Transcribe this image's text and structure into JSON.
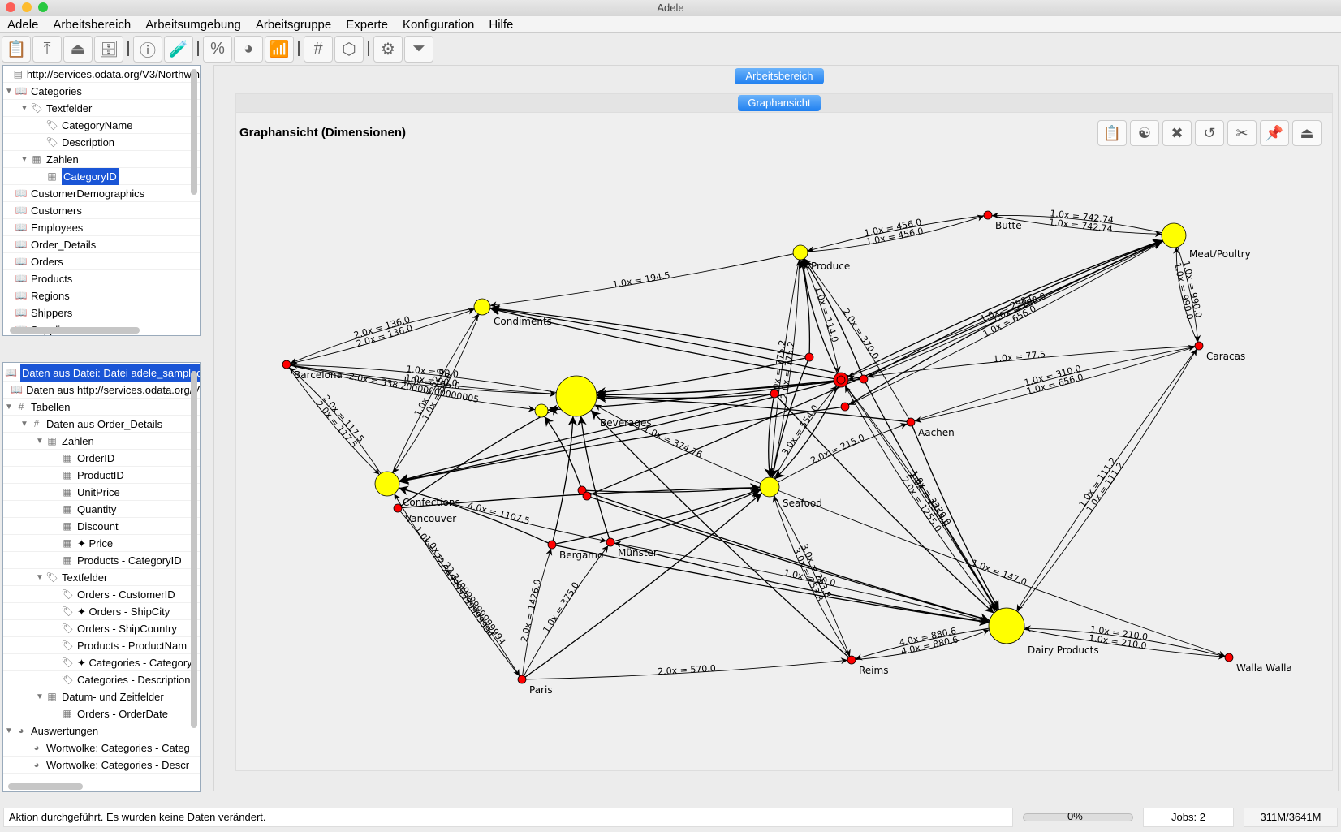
{
  "window": {
    "title": "Adele"
  },
  "menu": [
    "Adele",
    "Arbeitsbereich",
    "Arbeitsumgebung",
    "Arbeitsgruppe",
    "Experte",
    "Konfiguration",
    "Hilfe"
  ],
  "toolbar": [
    {
      "icon": "clipboard-icon",
      "g": "📋"
    },
    {
      "icon": "upload-icon",
      "g": "⤒"
    },
    {
      "icon": "eject-upload-icon",
      "g": "⏏"
    },
    {
      "icon": "cabinet-icon",
      "g": "🗄"
    },
    {
      "sep": true
    },
    {
      "icon": "info-icon",
      "g": "ⓘ"
    },
    {
      "icon": "test-tube-icon",
      "g": "🧪"
    },
    {
      "sep": true
    },
    {
      "icon": "percent-icon",
      "g": "%"
    },
    {
      "icon": "pie-chart-icon",
      "g": "◕"
    },
    {
      "icon": "bar-chart-icon",
      "g": "📶"
    },
    {
      "sep": true
    },
    {
      "icon": "grid-icon",
      "g": "#"
    },
    {
      "icon": "cube-icon",
      "g": "⬡"
    },
    {
      "sep": true
    },
    {
      "icon": "gear-bug-icon",
      "g": "⚙"
    },
    {
      "icon": "funnel-icon",
      "g": "⏷"
    }
  ],
  "source_tree": [
    {
      "label": "http://services.odata.org/V3/Northwin",
      "lvl": 0,
      "icon": "server-icon",
      "g": "▤"
    },
    {
      "label": "Categories",
      "lvl": 0,
      "icon": "book-icon",
      "g": "📖",
      "tw": "▼"
    },
    {
      "label": "Textfelder",
      "lvl": 1,
      "icon": "tag-icon",
      "g": "🏷",
      "tw": "▼"
    },
    {
      "label": "CategoryName",
      "lvl": 2,
      "icon": "tag-icon",
      "g": "🏷"
    },
    {
      "label": "Description",
      "lvl": 2,
      "icon": "tag-icon",
      "g": "🏷"
    },
    {
      "label": "Zahlen",
      "lvl": 1,
      "icon": "calculator-icon",
      "g": "▦",
      "tw": "▼"
    },
    {
      "label": "CategoryID",
      "lvl": 2,
      "icon": "calculator-icon",
      "g": "▦",
      "selected": true
    },
    {
      "label": "CustomerDemographics",
      "lvl": 0,
      "icon": "book-icon",
      "g": "📖"
    },
    {
      "label": "Customers",
      "lvl": 0,
      "icon": "book-icon",
      "g": "📖"
    },
    {
      "label": "Employees",
      "lvl": 0,
      "icon": "book-icon",
      "g": "📖"
    },
    {
      "label": "Order_Details",
      "lvl": 0,
      "icon": "book-icon",
      "g": "📖"
    },
    {
      "label": "Orders",
      "lvl": 0,
      "icon": "book-icon",
      "g": "📖"
    },
    {
      "label": "Products",
      "lvl": 0,
      "icon": "book-icon",
      "g": "📖"
    },
    {
      "label": "Regions",
      "lvl": 0,
      "icon": "book-icon",
      "g": "📖"
    },
    {
      "label": "Shippers",
      "lvl": 0,
      "icon": "book-icon",
      "g": "📖"
    },
    {
      "label": "Suppliers",
      "lvl": 0,
      "icon": "book-icon",
      "g": "📖"
    }
  ],
  "data_tree": [
    {
      "label": "Daten aus Datei: Datei adele_sampled",
      "lvl": 0,
      "icon": "book-icon",
      "g": "📖",
      "selected": true
    },
    {
      "label": "Daten aus http://services.odata.org/V",
      "lvl": 0,
      "icon": "book-icon",
      "g": "📖"
    },
    {
      "label": "Tabellen",
      "lvl": 0,
      "icon": "grid-icon",
      "g": "#",
      "tw": "▼"
    },
    {
      "label": "Daten aus Order_Details",
      "lvl": 1,
      "icon": "grid-icon",
      "g": "#",
      "tw": "▼"
    },
    {
      "label": "Zahlen",
      "lvl": 2,
      "icon": "calculator-icon",
      "g": "▦",
      "tw": "▼"
    },
    {
      "label": "OrderID",
      "lvl": 3,
      "icon": "calculator-icon",
      "g": "▦"
    },
    {
      "label": "ProductID",
      "lvl": 3,
      "icon": "calculator-icon",
      "g": "▦"
    },
    {
      "label": "UnitPrice",
      "lvl": 3,
      "icon": "calculator-icon",
      "g": "▦"
    },
    {
      "label": "Quantity",
      "lvl": 3,
      "icon": "calculator-icon",
      "g": "▦"
    },
    {
      "label": "Discount",
      "lvl": 3,
      "icon": "calculator-icon",
      "g": "▦"
    },
    {
      "label": "✦ Price",
      "lvl": 3,
      "icon": "calculator-icon",
      "g": "▦"
    },
    {
      "label": "Products - CategoryID",
      "lvl": 3,
      "icon": "calculator-icon",
      "g": "▦"
    },
    {
      "label": "Textfelder",
      "lvl": 2,
      "icon": "tag-icon",
      "g": "🏷",
      "tw": "▼"
    },
    {
      "label": "Orders - CustomerID",
      "lvl": 3,
      "icon": "tag-icon",
      "g": "🏷"
    },
    {
      "label": "✦ Orders - ShipCity",
      "lvl": 3,
      "icon": "tag-icon",
      "g": "🏷"
    },
    {
      "label": "Orders - ShipCountry",
      "lvl": 3,
      "icon": "tag-icon",
      "g": "🏷"
    },
    {
      "label": "Products - ProductNam",
      "lvl": 3,
      "icon": "tag-icon",
      "g": "🏷"
    },
    {
      "label": "✦ Categories - Category",
      "lvl": 3,
      "icon": "tag-icon",
      "g": "🏷"
    },
    {
      "label": "Categories - Description",
      "lvl": 3,
      "icon": "tag-icon",
      "g": "🏷"
    },
    {
      "label": "Datum- und Zeitfelder",
      "lvl": 2,
      "icon": "calendar-icon",
      "g": "▦",
      "tw": "▼"
    },
    {
      "label": "Orders - OrderDate",
      "lvl": 3,
      "icon": "calendar-icon",
      "g": "▦"
    },
    {
      "label": "Auswertungen",
      "lvl": 0,
      "icon": "pie-chart-icon",
      "g": "◕",
      "tw": "▼"
    },
    {
      "label": "Wortwolke: Categories - Categ",
      "lvl": 1,
      "icon": "pie-chart-icon",
      "g": "◕"
    },
    {
      "label": "Wortwolke: Categories - Descr",
      "lvl": 1,
      "icon": "pie-chart-icon",
      "g": "◕"
    }
  ],
  "workspace": {
    "tab": "Arbeitsbereich",
    "subtab": "Graphansicht",
    "title": "Graphansicht (Dimensionen)"
  },
  "graph_toolbar": [
    {
      "icon": "clipboard-icon",
      "g": "📋"
    },
    {
      "icon": "yin-yang-icon",
      "g": "☯"
    },
    {
      "icon": "close-icon",
      "g": "✖"
    },
    {
      "icon": "refresh-icon",
      "g": "↺"
    },
    {
      "icon": "tools-icon",
      "g": "✂"
    },
    {
      "icon": "pin-icon",
      "g": "📌"
    },
    {
      "icon": "eject-icon",
      "g": "⏏"
    }
  ],
  "graph": {
    "colors": {
      "category": "#ffff00",
      "city": "#ff0000",
      "edge": "#000000"
    },
    "nodes": [
      {
        "id": "butte",
        "name": "Butte",
        "type": "city"
      },
      {
        "id": "meat",
        "name": "Meat/Poultry",
        "type": "category"
      },
      {
        "id": "caracas",
        "name": "Caracas",
        "type": "city"
      },
      {
        "id": "walla",
        "name": "Walla Walla",
        "type": "city"
      },
      {
        "id": "dairy",
        "name": "Dairy Products",
        "type": "category"
      },
      {
        "id": "reims",
        "name": "Reims",
        "type": "city"
      },
      {
        "id": "paris",
        "name": "Paris",
        "type": "city"
      },
      {
        "id": "seafood",
        "name": "Seafood",
        "type": "category"
      },
      {
        "id": "munster",
        "name": "Münster",
        "type": "city"
      },
      {
        "id": "bergamo",
        "name": "Bergamo",
        "type": "city"
      },
      {
        "id": "vancouver",
        "name": "Vancouver",
        "type": "city"
      },
      {
        "id": "confections",
        "name": "Confections",
        "type": "category"
      },
      {
        "id": "barcelona",
        "name": "Barcelona",
        "type": "city"
      },
      {
        "id": "condiments",
        "name": "Condiments",
        "type": "category"
      },
      {
        "id": "beverages",
        "name": "Beverages",
        "type": "category"
      },
      {
        "id": "grains",
        "name": "",
        "type": "category"
      },
      {
        "id": "produce",
        "name": "Produce",
        "type": "category"
      },
      {
        "id": "aachen",
        "name": "Aachen",
        "type": "city"
      },
      {
        "id": "hub",
        "name": "",
        "type": "city"
      },
      {
        "id": "c1",
        "name": "",
        "type": "city"
      },
      {
        "id": "c2",
        "name": "",
        "type": "city"
      },
      {
        "id": "c3",
        "name": "",
        "type": "city"
      },
      {
        "id": "c4",
        "name": "",
        "type": "city"
      },
      {
        "id": "c5",
        "name": "",
        "type": "city"
      },
      {
        "id": "c6",
        "name": "",
        "type": "city"
      }
    ],
    "edges": [
      [
        "butte",
        "meat",
        "1.0x = 742.74"
      ],
      [
        "meat",
        "butte",
        "1.0x = 742.74"
      ],
      [
        "butte",
        "produce",
        "1.0x = 456.0"
      ],
      [
        "produce",
        "butte",
        "1.0x = 456.0"
      ],
      [
        "produce",
        "condiments",
        "1.0x = 194.5"
      ],
      [
        "barcelona",
        "condiments",
        "2.0x = 136.0"
      ],
      [
        "condiments",
        "barcelona",
        "2.0x = 136.0"
      ],
      [
        "barcelona",
        "beverages",
        "1.0x = 90.0"
      ],
      [
        "beverages",
        "barcelona",
        "1.0x = 90.0"
      ],
      [
        "barcelona",
        "grains",
        "2.0x = 338.20000000000005"
      ],
      [
        "barcelona",
        "beverages",
        "1.0x = 155.0"
      ],
      [
        "barcelona",
        "confections",
        "2.0x = 117.5"
      ],
      [
        "confections",
        "barcelona",
        "2.0x = 117.5"
      ],
      [
        "confections",
        "condiments",
        "1.0x = 52.0"
      ],
      [
        "condiments",
        "confections",
        "1.0x = 52.0"
      ],
      [
        "meat",
        "caracas",
        "1.0x = 990.0"
      ],
      [
        "caracas",
        "meat",
        "1.0x = 990.0"
      ],
      [
        "meat",
        "hub",
        "1.0x = 298.0"
      ],
      [
        "meat",
        "c4",
        "1.0x = 656.0"
      ],
      [
        "caracas",
        "aachen",
        "1.0x = 656.0"
      ],
      [
        "caracas",
        "dairy",
        "1.0x = 111.2"
      ],
      [
        "dairy",
        "caracas",
        "1.0x = 111.2"
      ],
      [
        "caracas",
        "hub",
        "1.0x = 77.5"
      ],
      [
        "aachen",
        "caracas",
        "1.0x = 310.0"
      ],
      [
        "dairy",
        "walla",
        "1.0x = 210.0"
      ],
      [
        "walla",
        "dairy",
        "1.0x = 210.0"
      ],
      [
        "seafood",
        "walla",
        "1.0x = 147.0"
      ],
      [
        "dairy",
        "reims",
        "4.0x = 880.6"
      ],
      [
        "reims",
        "dairy",
        "4.0x = 880.6"
      ],
      [
        "paris",
        "reims",
        "2.0x = 570.0"
      ],
      [
        "seafood",
        "reims",
        "3.0x = 253.8"
      ],
      [
        "reims",
        "seafood",
        "3.0x = 253.8"
      ],
      [
        "paris",
        "bergamo",
        "2.0x = 1426.0"
      ],
      [
        "paris",
        "munster",
        "1.0x = 375.0"
      ],
      [
        "vancouver",
        "paris",
        "1.0x = 22.349999999999994"
      ],
      [
        "paris",
        "confections",
        "1.0x = 22.349999999999994"
      ],
      [
        "seafood",
        "beverages",
        "1.0x = 374.76"
      ],
      [
        "hub",
        "dairy",
        "2.0x = 1255.0"
      ],
      [
        "dairy",
        "hub",
        "2.0x = 1255.0"
      ],
      [
        "produce",
        "seafood",
        "2.0x = 775.2"
      ],
      [
        "seafood",
        "produce",
        "2.0x = 775.2"
      ],
      [
        "aachen",
        "produce",
        "2.0x = 370.0"
      ],
      [
        "meat",
        "c3",
        "1.0x = 298.0"
      ],
      [
        "seafood",
        "hub",
        "3.0x = 554.0"
      ],
      [
        "seafood",
        "aachen",
        "2.0x = 215.0"
      ],
      [
        "confections",
        "munster",
        "4.0x = 1107.5"
      ],
      [
        "dairy",
        "munster",
        "1.0x = 30.0"
      ],
      [
        "hub",
        "dairy",
        "1.0x = 3270.0"
      ],
      [
        "produce",
        "hub",
        "1.0x = 114.0"
      ],
      [
        "hub",
        "beverages",
        ""
      ],
      [
        "c1",
        "beverages",
        ""
      ],
      [
        "c2",
        "beverages",
        ""
      ],
      [
        "c3",
        "beverages",
        ""
      ],
      [
        "c4",
        "confections",
        ""
      ],
      [
        "hub",
        "confections",
        ""
      ],
      [
        "c2",
        "confections",
        ""
      ],
      [
        "hub",
        "condiments",
        ""
      ],
      [
        "c1",
        "condiments",
        ""
      ],
      [
        "c3",
        "condiments",
        ""
      ],
      [
        "hub",
        "produce",
        ""
      ],
      [
        "c3",
        "produce",
        ""
      ],
      [
        "c5",
        "seafood",
        ""
      ],
      [
        "hub",
        "seafood",
        ""
      ],
      [
        "c1",
        "seafood",
        ""
      ],
      [
        "hub",
        "meat",
        ""
      ],
      [
        "c3",
        "meat",
        ""
      ],
      [
        "c6",
        "meat",
        ""
      ],
      [
        "c4",
        "meat",
        ""
      ],
      [
        "hub",
        "grains",
        ""
      ],
      [
        "c5",
        "grains",
        ""
      ],
      [
        "c6",
        "dairy",
        ""
      ],
      [
        "c5",
        "dairy",
        ""
      ],
      [
        "c3",
        "dairy",
        ""
      ],
      [
        "bergamo",
        "beverages",
        ""
      ],
      [
        "munster",
        "beverages",
        ""
      ],
      [
        "bergamo",
        "seafood",
        ""
      ],
      [
        "munster",
        "seafood",
        ""
      ],
      [
        "bergamo",
        "confections",
        ""
      ],
      [
        "munster",
        "dairy",
        ""
      ],
      [
        "bergamo",
        "dairy",
        ""
      ],
      [
        "vancouver",
        "beverages",
        ""
      ],
      [
        "vancouver",
        "seafood",
        ""
      ],
      [
        "c1",
        "produce",
        ""
      ],
      [
        "c2",
        "dairy",
        ""
      ],
      [
        "c2",
        "seafood",
        ""
      ],
      [
        "aachen",
        "dairy",
        ""
      ],
      [
        "aachen",
        "beverages",
        ""
      ],
      [
        "reims",
        "beverages",
        ""
      ],
      [
        "paris",
        "seafood",
        ""
      ]
    ]
  },
  "status": {
    "message": "Aktion durchgeführt. Es wurden keine Daten verändert.",
    "progress": 0,
    "progress_label": "0%",
    "jobs": "Jobs:  2",
    "memory": "311M/3641M"
  }
}
